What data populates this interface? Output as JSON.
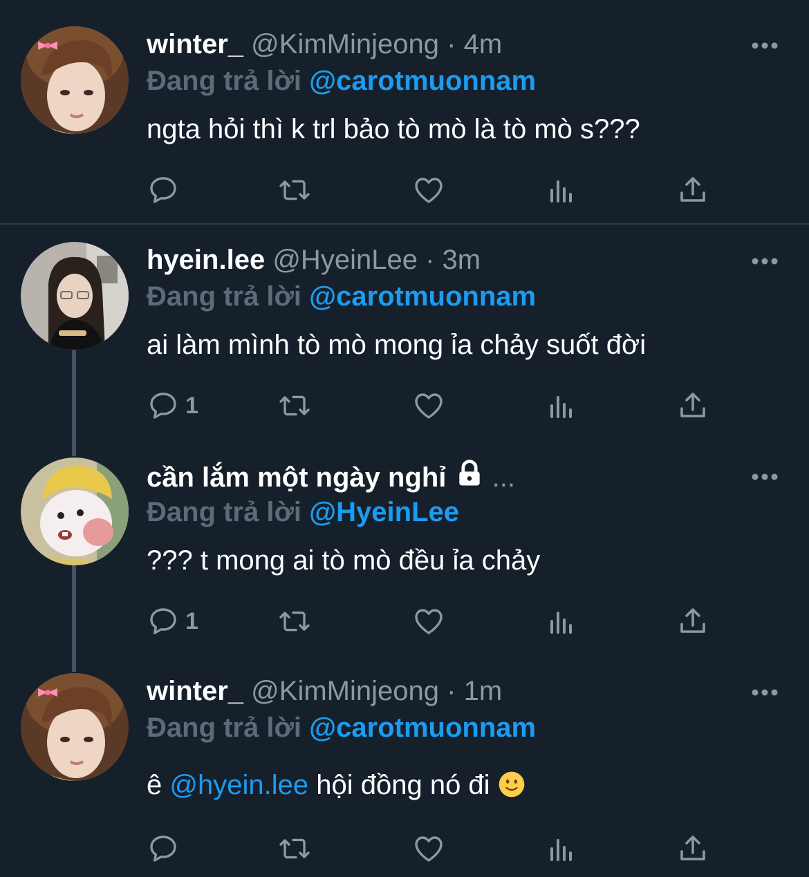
{
  "tweets": [
    {
      "name": "winter_",
      "handle": "@KimMinjeong",
      "sep": "·",
      "time": "4m",
      "reply_prefix": "Đang trả lời",
      "reply_to": "@carotmuonnam",
      "text": "ngta hỏi thì k trl bảo tò mò là tò mò s???",
      "reply_count": ""
    },
    {
      "name": "hyein.lee",
      "handle": "@HyeinLee",
      "sep": "·",
      "time": "3m",
      "reply_prefix": "Đang trả lời",
      "reply_to": "@carotmuonnam",
      "text": "ai làm mình tò mò mong ỉa chảy suốt đời",
      "reply_count": "1"
    },
    {
      "name": "cần lắm một ngày nghỉ",
      "handle": "...",
      "reply_prefix": "Đang trả lời",
      "reply_to": "@HyeinLee",
      "text": "??? t mong ai tò mò đều ỉa chảy",
      "reply_count": "1"
    },
    {
      "name": "winter_",
      "handle": "@KimMinjeong",
      "sep": "·",
      "time": "1m",
      "reply_prefix": "Đang trả lời",
      "reply_to": "@carotmuonnam",
      "text_before": "ê",
      "text_mention": "@hyein.lee",
      "text_after": "hội đồng nó đi",
      "reply_count": ""
    }
  ],
  "icons": {
    "reply": "reply-icon",
    "retweet": "retweet-icon",
    "like": "heart-icon",
    "views": "views-icon",
    "share": "share-icon",
    "more": "more-icon",
    "lock": "lock-icon",
    "emoji": "slightly-smiling-face-emoji"
  },
  "colors": {
    "background": "#15202b",
    "accent": "#1d9bf0",
    "secondary_text": "#8b98a5",
    "icon": "#8b98a5"
  }
}
